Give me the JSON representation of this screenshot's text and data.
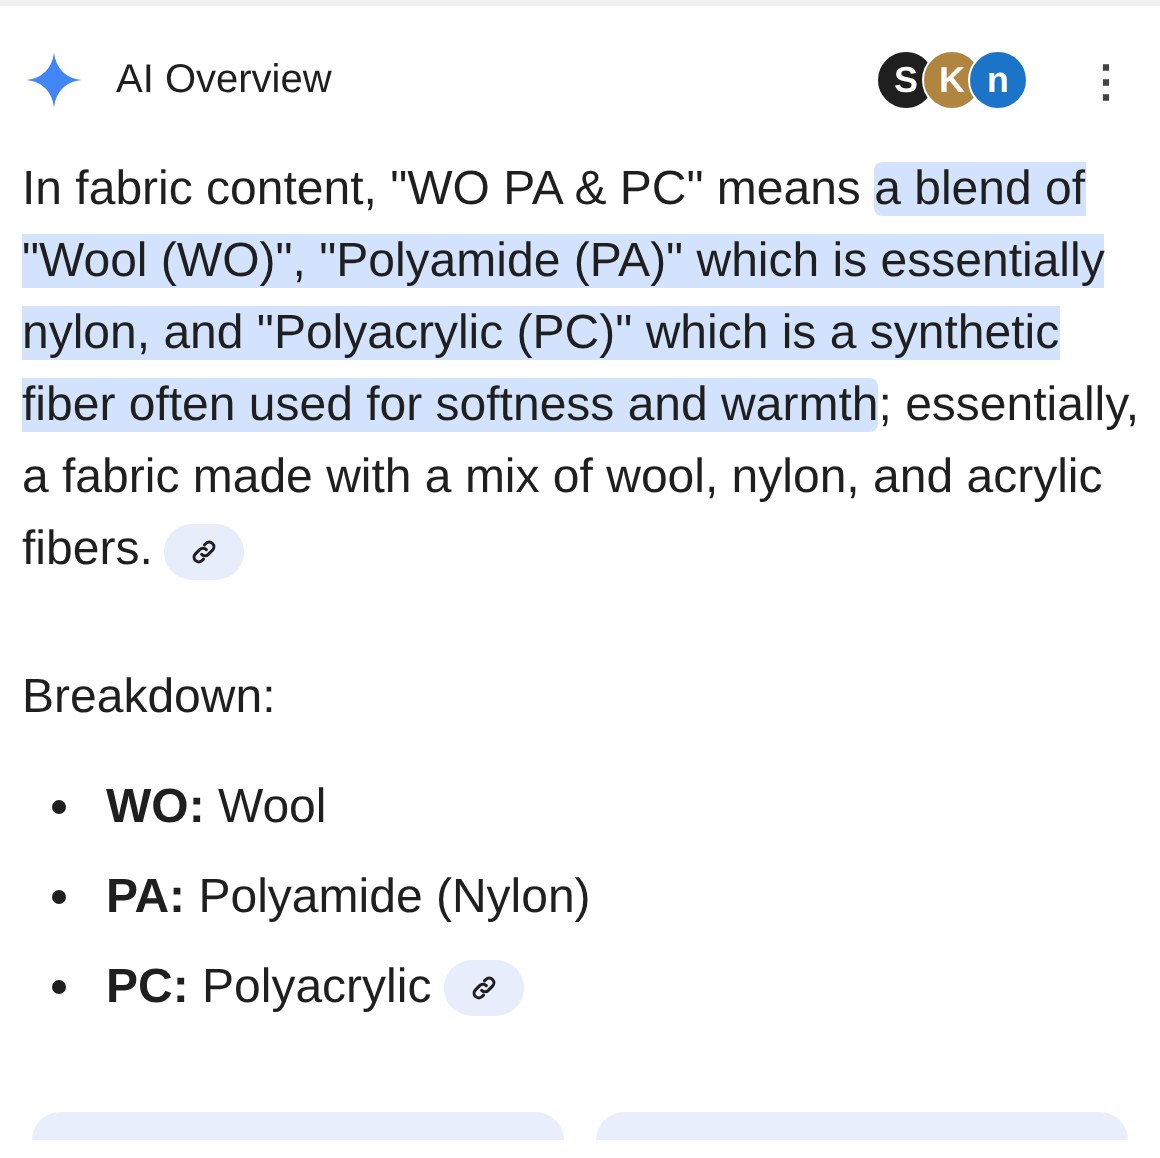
{
  "header": {
    "title": "AI Overview",
    "sources": [
      {
        "label": "S",
        "color": "#1f1f1f"
      },
      {
        "label": "K",
        "color": "#b08540"
      },
      {
        "label": "n",
        "color": "#1c74c9"
      }
    ],
    "menu": "⋮"
  },
  "paragraph": {
    "segments": [
      {
        "text": "In fabric content, \"WO PA & PC\" means ",
        "highlighted": false
      },
      {
        "text": "a blend of \"Wool (WO)\", \"Polyamide (PA)\" which is essentially nylon, and \"Polyacrylic (PC)\" which is a synthetic fiber often used for softness and warmth",
        "highlighted": true
      },
      {
        "text": "; essentially, a fabric made with a mix of wool, nylon, and acrylic fibers.",
        "highlighted": false
      }
    ],
    "link": true
  },
  "heading": "Breakdown:",
  "items": [
    {
      "term": "WO:",
      "text": "Wool",
      "link": false
    },
    {
      "term": "PA:",
      "text": "Polyamide (Nylon)",
      "link": false
    },
    {
      "term": "PC:",
      "text": "Polyacrylic",
      "link": true
    }
  ]
}
